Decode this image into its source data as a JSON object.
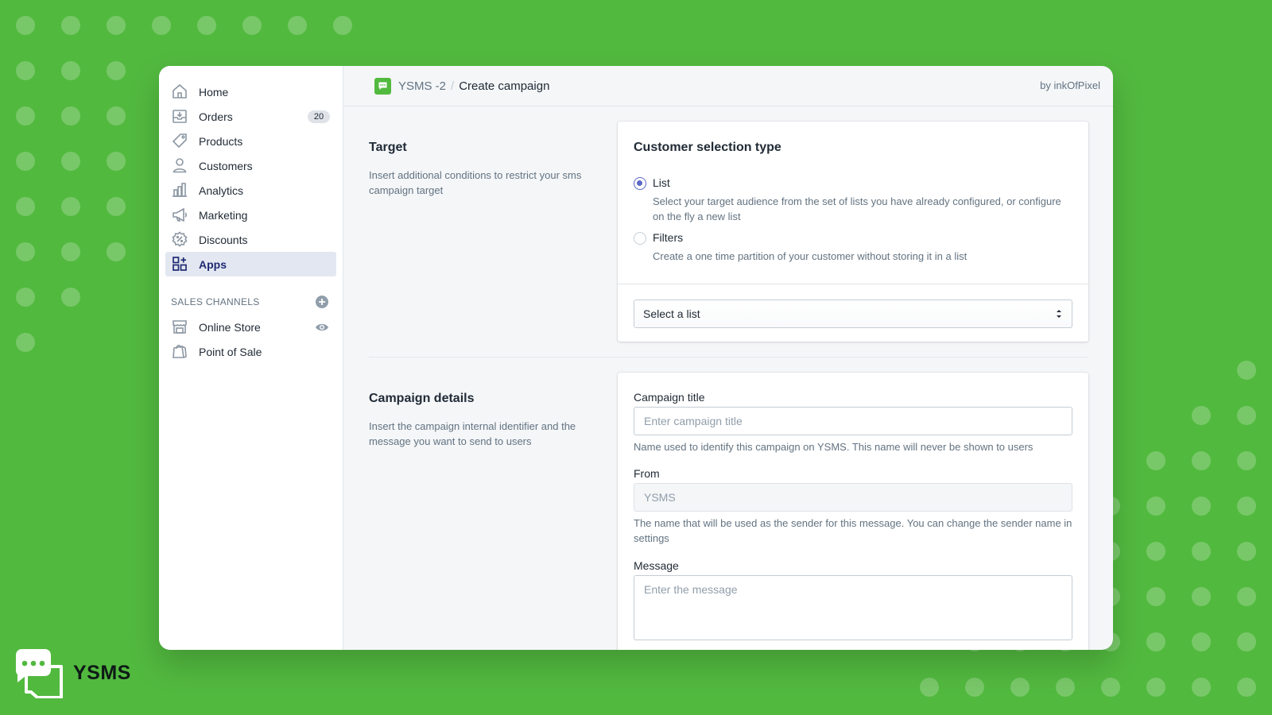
{
  "app": {
    "name": "YSMS -2",
    "page": "Create campaign",
    "byline": "by inkOfPixel",
    "brand_color": "#52b93f"
  },
  "sidebar": {
    "items": [
      {
        "label": "Home",
        "icon": "home-icon"
      },
      {
        "label": "Orders",
        "icon": "orders-icon",
        "badge": "20"
      },
      {
        "label": "Products",
        "icon": "tag-icon"
      },
      {
        "label": "Customers",
        "icon": "person-icon"
      },
      {
        "label": "Analytics",
        "icon": "bar-chart-icon"
      },
      {
        "label": "Marketing",
        "icon": "megaphone-icon"
      },
      {
        "label": "Discounts",
        "icon": "discount-icon"
      },
      {
        "label": "Apps",
        "icon": "apps-icon",
        "active": true
      }
    ],
    "sales_channels": {
      "header": "SALES CHANNELS",
      "items": [
        {
          "label": "Online Store",
          "icon": "store-icon"
        },
        {
          "label": "Point of Sale",
          "icon": "shopping-bag-icon"
        }
      ]
    }
  },
  "target_section": {
    "title": "Target",
    "description": "Insert additional conditions to restrict your sms campaign target",
    "card": {
      "title": "Customer selection type",
      "options": [
        {
          "label": "List",
          "help": "Select your target audience from the set of lists you have already configured, or configure on the fly a new list",
          "checked": true
        },
        {
          "label": "Filters",
          "help": "Create a one time partition of your customer without storing it in a list",
          "checked": false
        }
      ],
      "select_value": "Select a list"
    }
  },
  "details_section": {
    "title": "Campaign details",
    "description": "Insert the campaign internal identifier and the message you want to send to users",
    "fields": {
      "campaign_title": {
        "label": "Campaign title",
        "placeholder": "Enter campaign title",
        "help": "Name used to identify this campaign on YSMS. This name will never be shown to users"
      },
      "from": {
        "label": "From",
        "placeholder": "YSMS",
        "help": "The name that will be used as the sender for this message. You can change the sender name in settings"
      },
      "message": {
        "label": "Message",
        "placeholder": "Enter the message"
      }
    }
  },
  "brand": {
    "name": "YSMS"
  }
}
